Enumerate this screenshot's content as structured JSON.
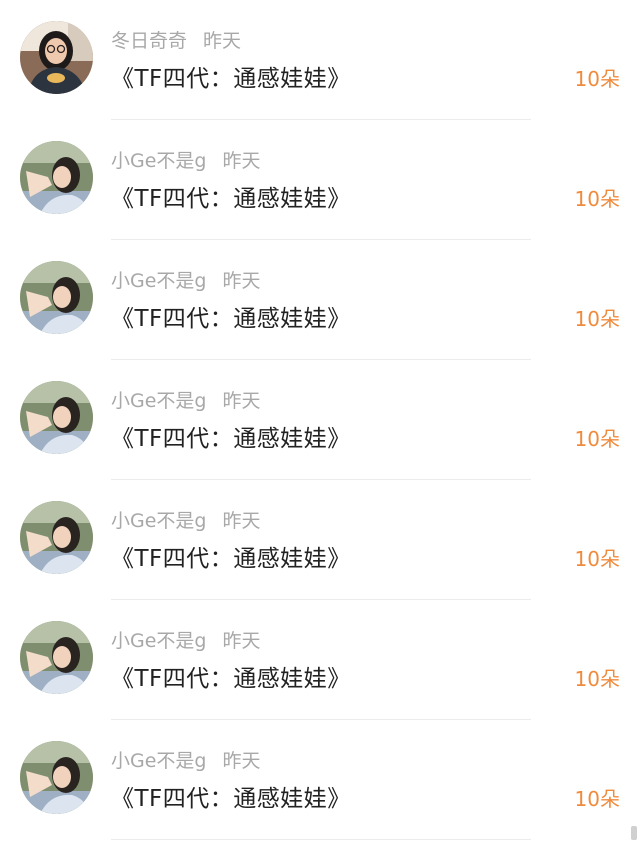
{
  "gifts": [
    {
      "user": "冬日奇奇",
      "time": "昨天",
      "title": "《TF四代：通感娃娃》",
      "count": "10朵",
      "avatar": "avatar-girl-glasses"
    },
    {
      "user": "小Ge不是g",
      "time": "昨天",
      "title": "《TF四代：通感娃娃》",
      "count": "10朵",
      "avatar": "avatar-girl-peace"
    },
    {
      "user": "小Ge不是g",
      "time": "昨天",
      "title": "《TF四代：通感娃娃》",
      "count": "10朵",
      "avatar": "avatar-girl-peace"
    },
    {
      "user": "小Ge不是g",
      "time": "昨天",
      "title": "《TF四代：通感娃娃》",
      "count": "10朵",
      "avatar": "avatar-girl-peace"
    },
    {
      "user": "小Ge不是g",
      "time": "昨天",
      "title": "《TF四代：通感娃娃》",
      "count": "10朵",
      "avatar": "avatar-girl-peace"
    },
    {
      "user": "小Ge不是g",
      "time": "昨天",
      "title": "《TF四代：通感娃娃》",
      "count": "10朵",
      "avatar": "avatar-girl-peace"
    },
    {
      "user": "小Ge不是g",
      "time": "昨天",
      "title": "《TF四代：通感娃娃》",
      "count": "10朵",
      "avatar": "avatar-girl-peace"
    }
  ],
  "colors": {
    "count": "#f08b3e",
    "meta": "#a8a8a8",
    "title": "#222222"
  }
}
